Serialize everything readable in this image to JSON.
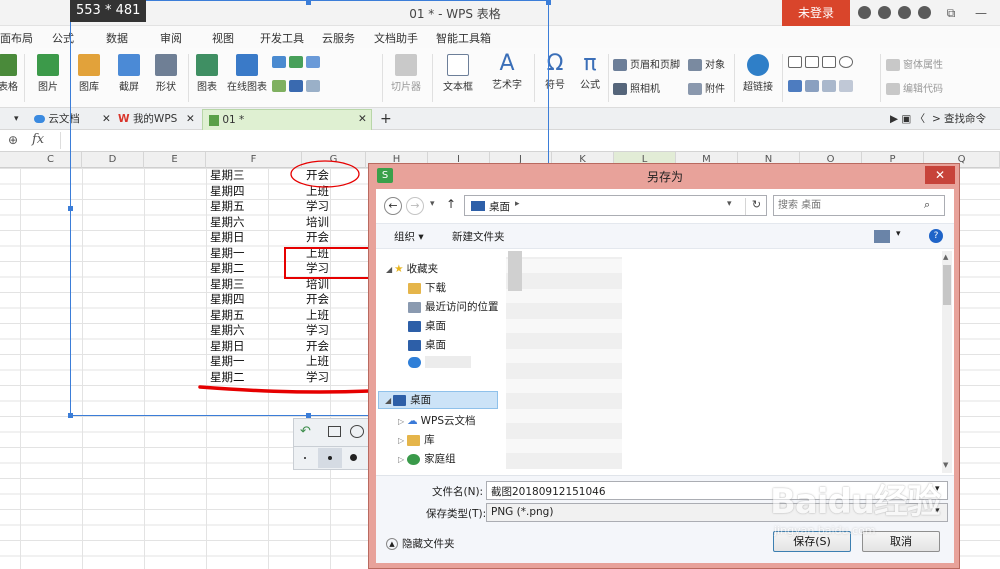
{
  "app": {
    "title": "01 * - WPS 表格",
    "login_label": "未登录",
    "window_controls": {
      "restore": "⧉",
      "minimize": "—"
    }
  },
  "menu": [
    "面布局",
    "公式",
    "数据",
    "审阅",
    "视图",
    "开发工具",
    "云服务",
    "文档助手",
    "智能工具箱"
  ],
  "ribbon": {
    "table_label": "表格",
    "picture": "图片",
    "gallery": "图库",
    "screenshot": "截屏",
    "shapes": "形状",
    "chart": "图表",
    "online_chart": "在线图表",
    "slicer": "切片器",
    "textbox": "文本框",
    "wordart": "艺术字",
    "symbol": "符号",
    "formula": "公式",
    "header_footer": "页眉和页脚",
    "object": "对象",
    "camera": "照相机",
    "attachment": "附件",
    "hyperlink": "超链接",
    "form_props": "窗体属性",
    "edit_code": "编辑代码",
    "symbol_glyph": "Ω",
    "formula_glyph": "π",
    "wordart_glyph": "A"
  },
  "tabs": {
    "cloud_docs": "云文档",
    "my_wps": "我的WPS",
    "doc": "01 *",
    "close_glyph": "✕",
    "add_glyph": "+",
    "find_cmd": "查找命令"
  },
  "formula_bar": {
    "fx": "fx"
  },
  "columns": [
    "C",
    "D",
    "E",
    "F",
    "G",
    "H",
    "I",
    "J",
    "K",
    "L",
    "M",
    "N",
    "O",
    "P",
    "Q"
  ],
  "sheet": {
    "rows": [
      {
        "day": "星期三",
        "task": "开会"
      },
      {
        "day": "星期四",
        "task": "上班"
      },
      {
        "day": "星期五",
        "task": "学习"
      },
      {
        "day": "星期六",
        "task": "培训"
      },
      {
        "day": "星期日",
        "task": "开会"
      },
      {
        "day": "星期一",
        "task": "上班"
      },
      {
        "day": "星期二",
        "task": "学习"
      },
      {
        "day": "星期三",
        "task": "培训"
      },
      {
        "day": "星期四",
        "task": "开会"
      },
      {
        "day": "星期五",
        "task": "上班"
      },
      {
        "day": "星期六",
        "task": "学习"
      },
      {
        "day": "星期日",
        "task": "开会"
      },
      {
        "day": "星期一",
        "task": "上班"
      },
      {
        "day": "星期二",
        "task": "学习"
      }
    ]
  },
  "capture": {
    "size_label": "553 * 481"
  },
  "dialog": {
    "title": "另存为",
    "close_glyph": "✕",
    "path": "桌面",
    "path_sep": "▸",
    "search_placeholder": "搜索 桌面",
    "organize": "组织 ▾",
    "new_folder": "新建文件夹",
    "tree": {
      "favorites": "收藏夹",
      "downloads": "下载",
      "recent": "最近访问的位置",
      "desktop1": "桌面",
      "desktop2": "桌面",
      "desktop_root": "桌面",
      "wps_cloud": "WPS云文档",
      "library": "库",
      "homegroup": "家庭组"
    },
    "filename_label": "文件名(N):",
    "filename_value": "截图20180912151046",
    "filetype_label": "保存类型(T):",
    "filetype_value": "PNG (*.png)",
    "hide_folders": "隐藏文件夹",
    "save_button": "保存(S)",
    "cancel_button": "取消"
  },
  "watermark": {
    "brand": "Baidu经验",
    "url": "jingyan.baidu.com"
  },
  "colors": {
    "accent_red": "#d9452b",
    "dialog_frame": "#e8a29a",
    "selection_blue": "#3b7dd8",
    "annotation_red": "#e60000"
  }
}
